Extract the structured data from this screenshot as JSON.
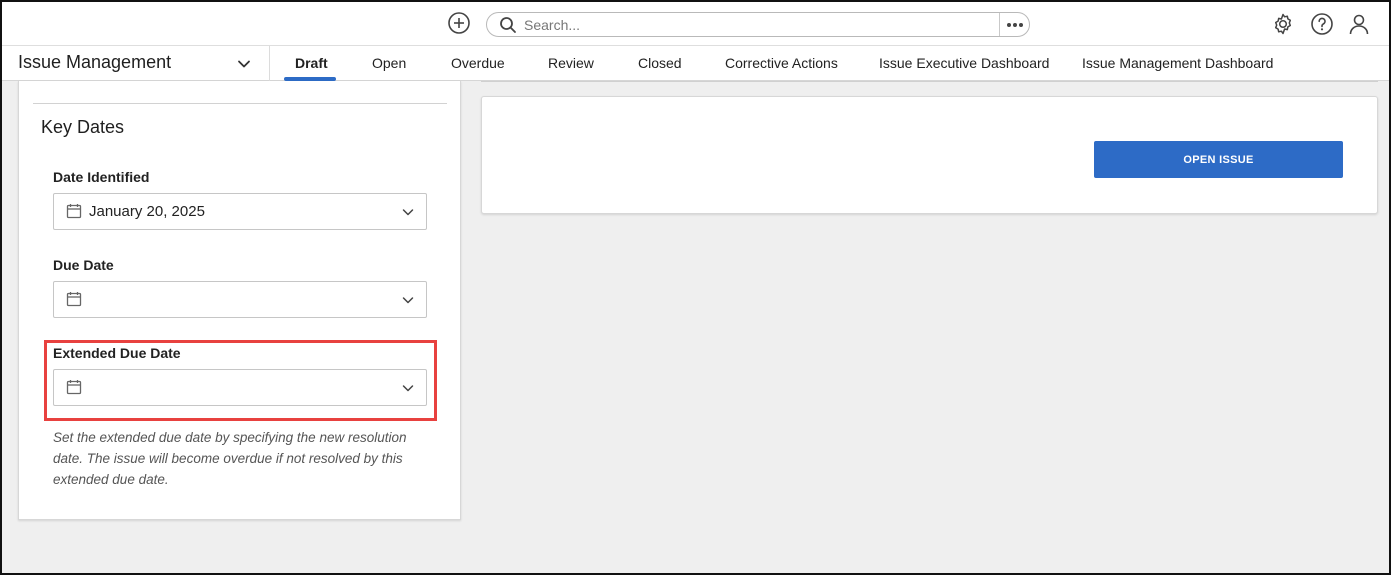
{
  "header": {
    "search_placeholder": "Search...",
    "icons": {
      "add": "plus-circle-icon",
      "search": "search-icon",
      "more": "more-horizontal-icon",
      "settings": "gear-icon",
      "help": "question-circle-icon",
      "user": "user-icon"
    }
  },
  "nav": {
    "app_title": "Issue Management",
    "tabs": [
      {
        "label": "Draft",
        "active": true
      },
      {
        "label": "Open"
      },
      {
        "label": "Overdue"
      },
      {
        "label": "Review"
      },
      {
        "label": "Closed"
      },
      {
        "label": "Corrective Actions"
      },
      {
        "label": "Issue Executive Dashboard"
      },
      {
        "label": "Issue Management Dashboard"
      }
    ]
  },
  "key_dates": {
    "title": "Key Dates",
    "date_identified": {
      "label": "Date Identified",
      "value": "January 20, 2025"
    },
    "due_date": {
      "label": "Due Date",
      "value": ""
    },
    "extended_due_date": {
      "label": "Extended Due Date",
      "value": ""
    },
    "help_text": "Set the extended due date by specifying the new resolution date. The issue will become overdue if not resolved by this extended due date."
  },
  "actions": {
    "open_issue_label": "OPEN ISSUE"
  },
  "colors": {
    "accent": "#2d6bc6",
    "highlight": "#e8413f"
  }
}
